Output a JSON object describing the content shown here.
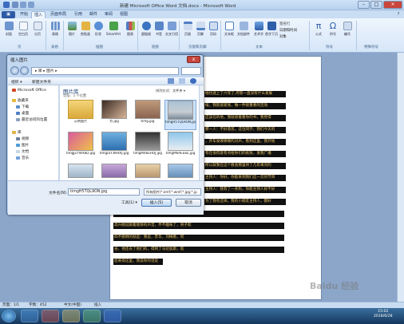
{
  "window": {
    "title": "新建 Microsoft Office Word 文档.docx - Microsoft Word"
  },
  "tabs": [
    "开始",
    "插入",
    "页面布局",
    "引用",
    "邮件",
    "审阅",
    "视图"
  ],
  "active_tab": "插入",
  "ribbon": {
    "buttons": [
      "封面",
      "空白页",
      "分页",
      "表格",
      "图片",
      "剪贴画",
      "形状",
      "SmartArt",
      "图表",
      "超链接",
      "书签",
      "交叉引用",
      "页眉",
      "页脚",
      "页码",
      "文本框",
      "文档部件",
      "艺术字",
      "首字下沉",
      "公式",
      "符号",
      "编号"
    ],
    "side_labels": [
      "签名行",
      "日期和时间",
      "对象"
    ],
    "groups": [
      "页",
      "表格",
      "插图",
      "链接",
      "页眉和页脚",
      "文本",
      "符号",
      "特殊符号"
    ]
  },
  "dialog": {
    "title": "插入图片",
    "close": "x",
    "address": "▸ 库 ▸ 图片 ▸",
    "toolbar": {
      "organize": "组织 ▾",
      "new_folder": "新建文件夹"
    },
    "nav": [
      "Microsoft Office",
      "收藏夹",
      "下载",
      "桌面",
      "最近访问的位置",
      "库",
      "视频",
      "图片",
      "文档",
      "音乐"
    ],
    "library": {
      "title": "图片库",
      "subtitle": "包括：1 个位置",
      "arrange": "排列方式：文件夹 ▾"
    },
    "files": [
      "示例图片",
      "为.jpg",
      "timg.jpg",
      "timgH5TQL9ON.jpg",
      "timgJZYWX8D.jpg",
      "timgLVCNF8XJ.jpg",
      "timgMXBLHOJ.jpg",
      "timgM6AEE8Z.jpg",
      "",
      "",
      "",
      ""
    ],
    "filename_label": "文件名(N):",
    "filename_value": "timgH5TQL9ON.jpg",
    "filetype": "所有图片(*.emf;*.wmf;*.jpg;*.jp",
    "tools": "工具(L) ▾",
    "insert": "插入(S)",
    "cancel": "取消"
  },
  "document": {
    "lines": [
      "她也迷上了六年了,尽管一直没有什么发展",
      "候，我就很紧张，做一件很重要的活动",
      "应该在的地，我就接着看你的书，我觉得",
      "那一人：不好意思，这位同学，我们今天的",
      "，开车发哪哪哪的对声，看到这里，我开始",
      "有在很得意有点给你们的纸张，发我广播",
      "所以就我在这个教会那里待了几年来问的",
      "主持人：你好，你能来到我们这一次的节目",
      "主持人：我有了一条狗，你能主持人好不好",
      "为了我有这样，我的小朋友主持人，都好",
      "高兴她说跟着能够的声音，弄不趣味了，男",
      "高兴她说跟着能够的声音，弄不趣味了，男子就",
      "四不愿倒的就是：我说，苏华，刘梅看，阿",
      "谷，他还去了他们的，得到了马达加斯，就",
      "后来得这里，我说你的话说"
    ]
  },
  "status": {
    "page": "页面：1/1",
    "words": "字数：452",
    "lang": "中文(中国)",
    "mode": "插入"
  },
  "taskbar": {
    "time": "15:02",
    "date": "2018/6/28"
  },
  "watermark": "Baidu 经验"
}
